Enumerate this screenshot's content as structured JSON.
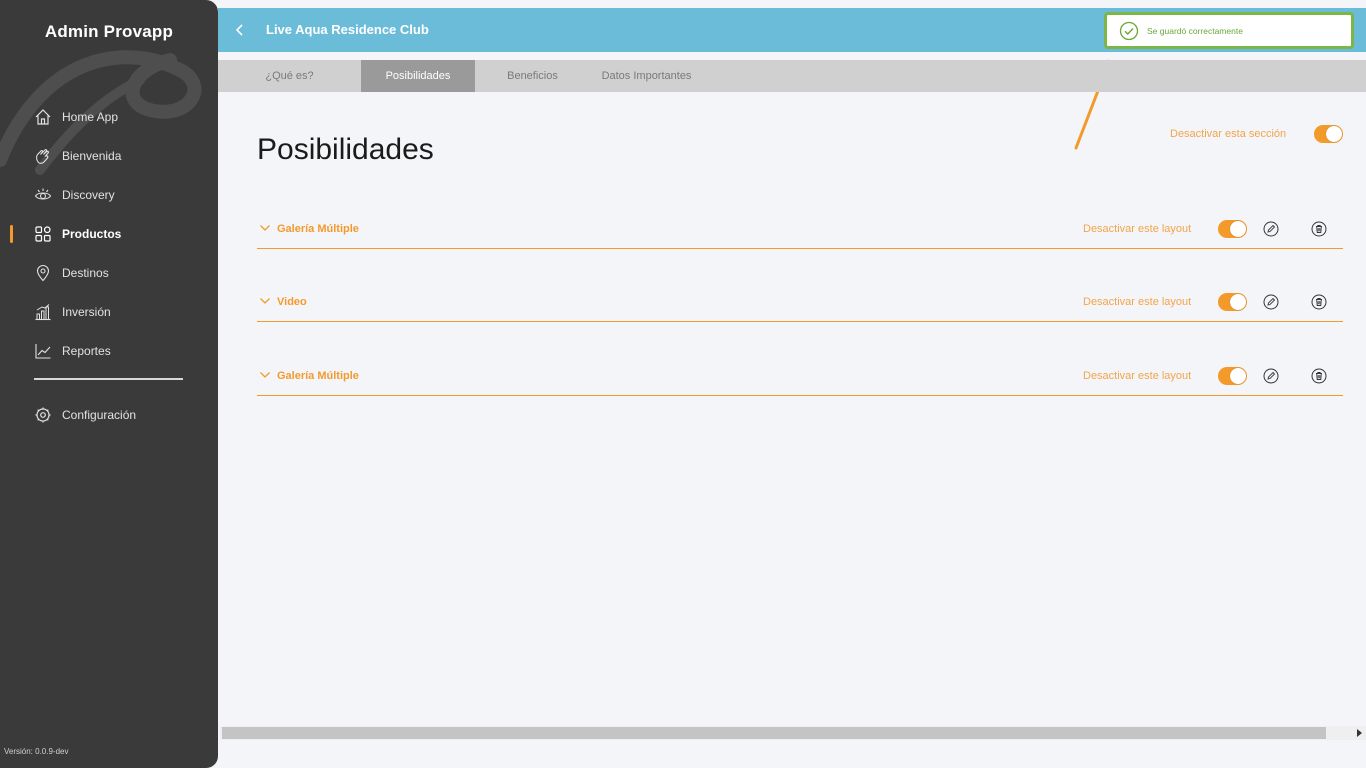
{
  "sidebar": {
    "brand": "Admin Provapp",
    "items": [
      {
        "label": "Home App",
        "icon": "home-icon"
      },
      {
        "label": "Bienvenida",
        "icon": "wave-hand-icon"
      },
      {
        "label": "Discovery",
        "icon": "eye-icon"
      },
      {
        "label": "Productos",
        "icon": "grid-icon",
        "active": true
      },
      {
        "label": "Destinos",
        "icon": "location-pin-icon"
      },
      {
        "label": "Inversión",
        "icon": "bar-chart-icon"
      },
      {
        "label": "Reportes",
        "icon": "line-chart-icon"
      }
    ],
    "config": {
      "label": "Configuración",
      "icon": "gear-icon"
    },
    "version": "Versión: 0.0.9-dev"
  },
  "header": {
    "title": "Live Aqua Residence Club",
    "background": "#6bbcd9"
  },
  "toast": {
    "text": "Se guardó correctamente",
    "color": "#7ab648"
  },
  "tabs": [
    {
      "label": "¿Qué es?"
    },
    {
      "label": "Posibilidades",
      "active": true
    },
    {
      "label": "Beneficios"
    },
    {
      "label": "Datos Importantes"
    }
  ],
  "main": {
    "title": "Posibilidades",
    "section_toggle_label": "Desactivar esta sección",
    "accent": "#f39a2b",
    "layouts": [
      {
        "title": "Galería Múltiple",
        "toggle_label": "Desactivar este layout"
      },
      {
        "title": "Video",
        "toggle_label": "Desactivar este layout"
      },
      {
        "title": "Galería Múltiple",
        "toggle_label": "Desactivar este layout"
      }
    ]
  }
}
